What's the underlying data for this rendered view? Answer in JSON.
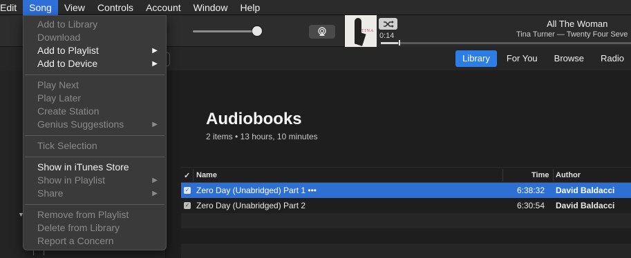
{
  "menubar": {
    "items": [
      "Edit",
      "Song",
      "View",
      "Controls",
      "Account",
      "Window",
      "Help"
    ],
    "active": "Song"
  },
  "player": {
    "elapsed": "0:14",
    "title": "All The Woman",
    "subtitle": "Tina Turner — Twenty Four Seve",
    "art_text": "TINA",
    "progress_fraction": 0.07
  },
  "nav": {
    "tabs": [
      "Library",
      "For You",
      "Browse",
      "Radio"
    ],
    "active": "Library"
  },
  "page": {
    "title": "Audiobooks",
    "meta": "2 items • 13 hours, 10 minutes"
  },
  "table": {
    "headers": {
      "check": "✓",
      "name": "Name",
      "time": "Time",
      "author": "Author"
    },
    "rows": [
      {
        "name": "Zero Day (Unabridged) Part 1 •••",
        "time": "6:38:32",
        "author": "David Baldacci",
        "selected": true
      },
      {
        "name": "Zero Day (Unabridged) Part 2",
        "time": "6:30:54",
        "author": "David Baldacci",
        "selected": false
      }
    ]
  },
  "menu": {
    "items": [
      {
        "label": "Add to Library",
        "enabled": false,
        "submenu": false
      },
      {
        "label": "Download",
        "enabled": false,
        "submenu": false
      },
      {
        "label": "Add to Playlist",
        "enabled": true,
        "submenu": true
      },
      {
        "label": "Add to Device",
        "enabled": true,
        "submenu": true
      },
      {
        "label": "Play Next",
        "enabled": false,
        "submenu": false
      },
      {
        "label": "Play Later",
        "enabled": false,
        "submenu": false
      },
      {
        "label": "Create Station",
        "enabled": false,
        "submenu": false
      },
      {
        "label": "Genius Suggestions",
        "enabled": false,
        "submenu": true
      },
      {
        "label": "Tick Selection",
        "enabled": false,
        "submenu": false
      },
      {
        "label": "Show in iTunes Store",
        "enabled": true,
        "submenu": false
      },
      {
        "label": "Show in Playlist",
        "enabled": false,
        "submenu": true
      },
      {
        "label": "Share",
        "enabled": false,
        "submenu": true
      },
      {
        "label": "Remove from Playlist",
        "enabled": false,
        "submenu": false
      },
      {
        "label": "Delete from Library",
        "enabled": false,
        "submenu": false
      },
      {
        "label": "Report a Concern",
        "enabled": false,
        "submenu": false
      }
    ]
  },
  "colors": {
    "accent": "#2c7ee6",
    "selection": "#2d6fd3",
    "menu_highlight": "#2f6fd8"
  }
}
